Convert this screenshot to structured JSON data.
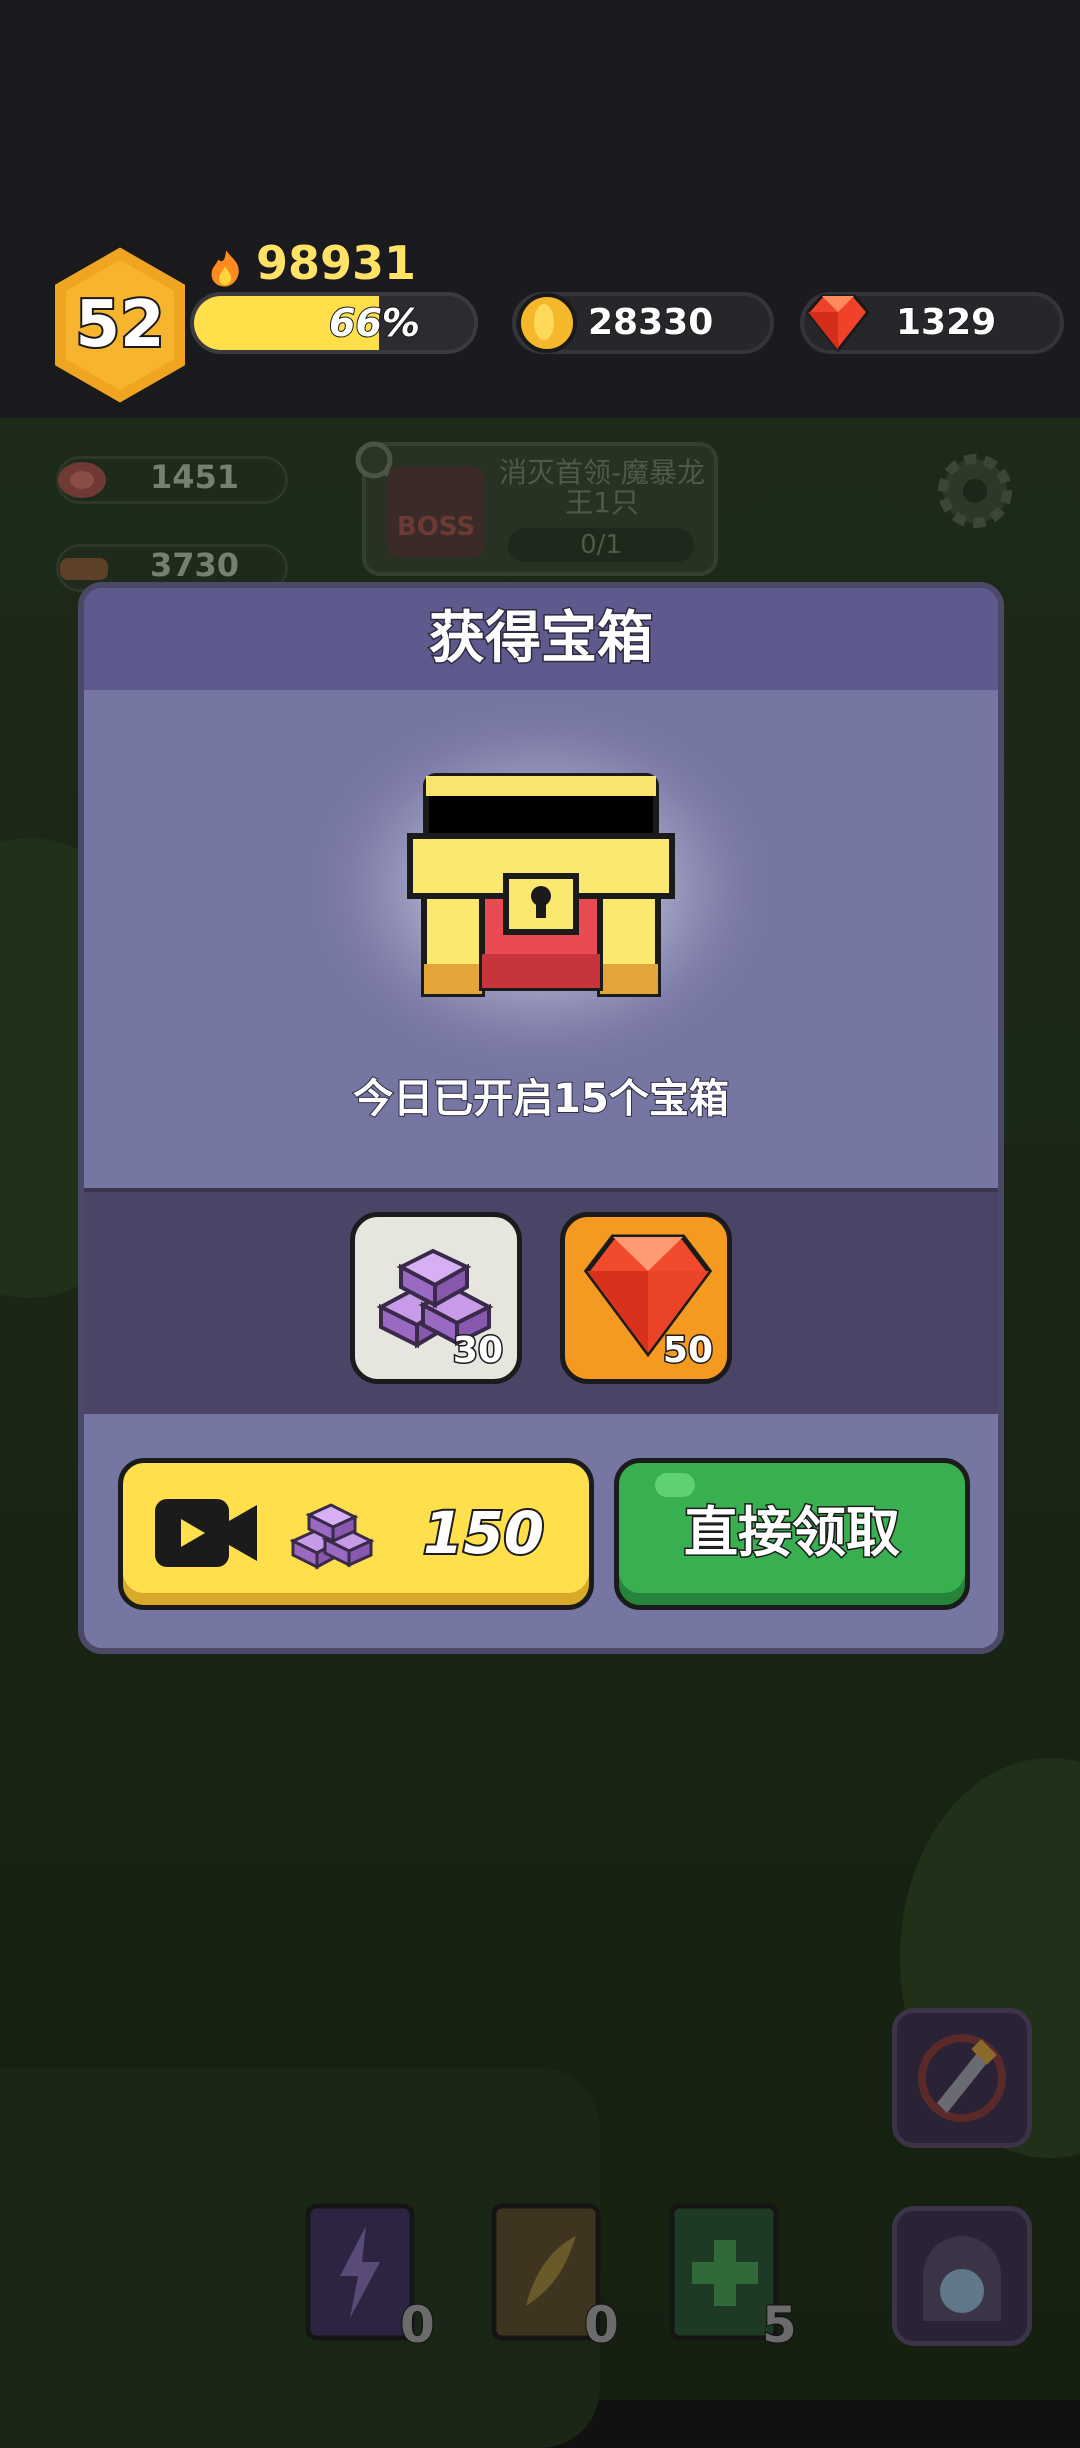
{
  "player": {
    "level": "52",
    "power": "98931",
    "xp_label": "66%",
    "xp_fraction": 0.66
  },
  "currencies": {
    "gold": "28330",
    "gems": "1329"
  },
  "resources": {
    "meat": "1451",
    "wood": "3730"
  },
  "boss_quest": {
    "badge": "BOSS",
    "text": "消灭首领-魔暴龙王1只",
    "progress": "0/1"
  },
  "dialog": {
    "title": "获得宝箱",
    "opened_text": "今日已开启15个宝箱",
    "rewards": [
      {
        "item": "purple-ingot",
        "count": "30"
      },
      {
        "item": "red-gem",
        "count": "50"
      }
    ],
    "video_button_amount": "150",
    "claim_button_label": "直接领取"
  },
  "bottom_books": [
    {
      "name": "lightning-book",
      "count": "0"
    },
    {
      "name": "wing-book",
      "count": "0"
    },
    {
      "name": "heal-book",
      "count": "5"
    }
  ],
  "colors": {
    "dialog_body": "#7676a2",
    "dialog_header": "#5e5a8e",
    "reward_band": "#4a4466",
    "video_button": "#ffe04c",
    "claim_button": "#38b050",
    "power_text": "#ffe266"
  }
}
